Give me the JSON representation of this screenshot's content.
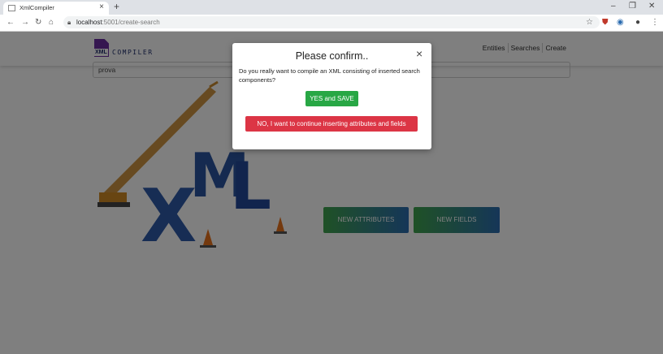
{
  "browser": {
    "tab_title": "XmlCompiler",
    "tab_close": "×",
    "new_tab": "+",
    "url_host": "localhost",
    "url_rest": ":5001/create-search",
    "win_min": "–",
    "win_restore": "❐",
    "win_close": "✕"
  },
  "navbar": {
    "logo_badge": "XML",
    "logo_text": "COMPILER",
    "links": [
      "Entities",
      "Searches",
      "Create"
    ]
  },
  "page": {
    "search_value": "prova",
    "new_attributes_label": "NEW ATTRIBUTES",
    "new_fields_label": "NEW FIELDS"
  },
  "art": {
    "letters": [
      "X",
      "M",
      "L"
    ]
  },
  "modal": {
    "title": "Please confirm..",
    "close": "×",
    "message": "Do you really want to compile an XML consisting of inserted search components?",
    "yes_label": "YES and SAVE",
    "no_label": "NO, I want to continue inserting attributes and fields"
  },
  "colors": {
    "yes": "#28a745",
    "no": "#dc3545",
    "button_gradient_start": "#3fa34d",
    "button_gradient_end": "#2b6cb0",
    "logo_purple": "#6b2fa0"
  }
}
